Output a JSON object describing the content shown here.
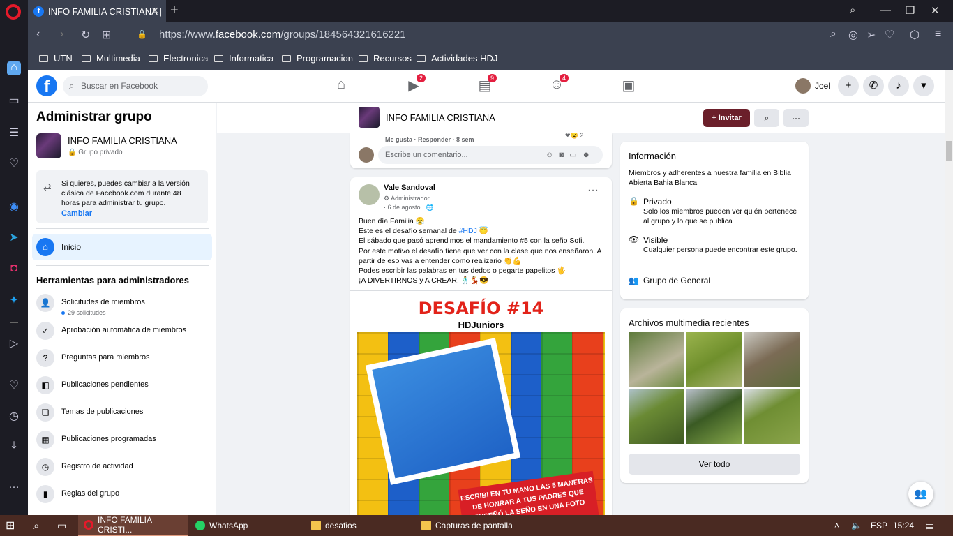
{
  "browser": {
    "tab_title": "INFO FAMILIA CRISTIANA |",
    "url_prefix": "https://www.",
    "url_domain": "facebook.com",
    "url_path": "/groups/184564321616221",
    "bookmarks": [
      "UTN",
      "Multimedia",
      "Electronica",
      "Informatica",
      "Programacion",
      "Recursos",
      "Actividades HDJ"
    ]
  },
  "fb_header": {
    "search_placeholder": "Buscar en Facebook",
    "badges": {
      "watch": "2",
      "marketplace": "9",
      "groups": "4"
    },
    "user_name": "Joel"
  },
  "left_panel": {
    "title": "Administrar grupo",
    "group_name": "INFO FAMILIA CRISTIANA",
    "group_privacy": "Grupo privado",
    "switch_text": "Si quieres, puedes cambiar a la versión clásica de Facebook.com durante 48 horas para administrar tu grupo.",
    "switch_link": "Cambiar",
    "home_label": "Inicio",
    "tools_title": "Herramientas para administradores",
    "tools": [
      {
        "label": "Solicitudes de miembros",
        "sub": "29 solicitudes",
        "icon": "person-add-icon"
      },
      {
        "label": "Aprobación automática de miembros",
        "icon": "person-check-icon"
      },
      {
        "label": "Preguntas para miembros",
        "icon": "question-icon"
      },
      {
        "label": "Publicaciones pendientes",
        "icon": "pending-icon"
      },
      {
        "label": "Temas de publicaciones",
        "icon": "topics-icon"
      },
      {
        "label": "Publicaciones programadas",
        "icon": "calendar-icon"
      },
      {
        "label": "Registro de actividad",
        "icon": "clock-icon"
      },
      {
        "label": "Reglas del grupo",
        "icon": "book-icon"
      }
    ]
  },
  "group_bar": {
    "name": "INFO FAMILIA CRISTIANA",
    "invite_label": "Invitar"
  },
  "comment_card": {
    "actions": "Me gusta · Responder · 8 sem",
    "reaction_count": "2",
    "placeholder": "Escribe un comentario..."
  },
  "post": {
    "author": "Vale Sandoval",
    "role": "Administrador",
    "date": "· 6 de agosto · ",
    "lines": [
      "Buen día Familia 😤",
      "Este es el desafío semanal de ",
      "El sábado que pasó aprendimos el mandamiento #5 con la seño Sofi.",
      "Por este motivo el desafío tiene que ver con la clase que nos enseñaron. A partir de eso vas a entender como realizario 👏💪",
      "Podes escribir las palabras en tus dedos o pegarte papelitos 🖐",
      "¡A DIVERTIRNOS y A CREAR! 🕺💃😎"
    ],
    "hashtag": "#HDJ",
    "hashtag_emoji": " 😇",
    "image_title": "DESAFÍO #14",
    "image_subtitle": "HDJuniors",
    "image_banner": "ESCRIBI EN TU MANO LAS 5 MANERAS DE HONRAR A TUS PADRES QUE ENSEÑÓ LA SEÑO EN UNA FOTO"
  },
  "info_card": {
    "title": "Información",
    "description": "Miembros y adherentes a nuestra familia en Biblia Abierta Bahia Blanca",
    "private_title": "Privado",
    "private_desc": "Solo los miembros pueden ver quién pertenece al grupo y lo que se publica",
    "visible_title": "Visible",
    "visible_desc": "Cualquier persona puede encontrar este grupo.",
    "type_title": "Grupo de General"
  },
  "media_card": {
    "title": "Archivos multimedia recientes",
    "see_all": "Ver todo"
  },
  "taskbar": {
    "items": [
      "INFO FAMILIA CRISTI...",
      "WhatsApp",
      "desafios",
      "Capturas de pantalla"
    ],
    "lang": "ESP",
    "time": "15:24"
  },
  "colors": {
    "fb_blue": "#1877f2",
    "invite_bg": "#6b1f2a",
    "chrome_bg": "#3b4150",
    "taskbar_bg": "#4a2a22"
  }
}
